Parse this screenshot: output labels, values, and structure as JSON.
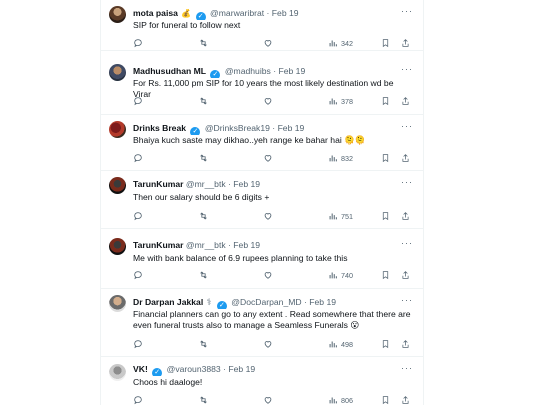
{
  "tweets": [
    {
      "name": "mota paisa",
      "name_emoji": "💰",
      "handle": "@marwaribrat",
      "date": "Feb 19",
      "text": "SIP for funeral to follow next",
      "views": "342",
      "verified": true
    },
    {
      "name": "Madhusudhan ML",
      "handle": "@madhuibs",
      "date": "Feb 19",
      "text": "For Rs. 11,000 pm SIP for 10 years the most likely destination wd be Virar",
      "views": "378",
      "verified": true
    },
    {
      "name": "Drinks Break",
      "handle": "@DrinksBreak19",
      "date": "Feb 19",
      "text": "Bhaiya kuch saste may dikhao..yeh range ke bahar hai",
      "views": "832",
      "verified": true,
      "trailing_emojis": "🫠🫠"
    },
    {
      "name": "TarunKumar",
      "handle": "@mr__btk",
      "date": "Feb 19",
      "text": "Then our salary should be 6 digits +",
      "views": "751",
      "verified": false
    },
    {
      "name": "TarunKumar",
      "handle": "@mr__btk",
      "date": "Feb 19",
      "text": "Me with bank balance of 6.9 rupees planning to take this",
      "views": "740",
      "verified": false
    },
    {
      "name": "Dr Darpan Jakkal",
      "name_emoji": "⚕",
      "handle": "@DocDarpan_MD",
      "date": "Feb 19",
      "text_lines": [
        "Financial planners can go to any extent . Read somewhere that there are",
        "even funeral trusts also to manage a Seamless Funerals"
      ],
      "views": "498",
      "verified": true,
      "trailing_emojis": "😮"
    },
    {
      "name": "VK!",
      "handle": "@varoun3883",
      "date": "Feb 19",
      "text": "Choos hi daaloge!",
      "views": "806",
      "verified": true
    }
  ],
  "ui": {
    "dot": "·",
    "more": "···",
    "verified_mark": "✓"
  },
  "colors": {
    "text": "#0f1419",
    "secondary": "#536471",
    "verified": "#1d9bf0",
    "divider": "#eff3f4"
  }
}
